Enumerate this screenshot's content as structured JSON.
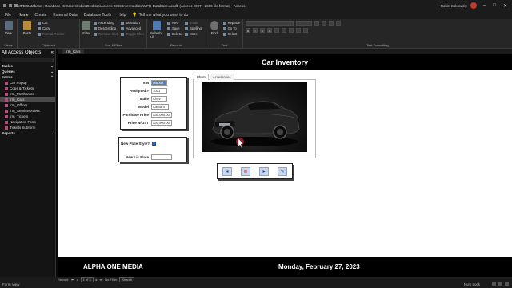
{
  "window": {
    "title": "MPD Database : Database- C:\\Users\\robin\\Desktop\\Access 0365 Intermediate\\MPD Database.accdb (Access 2007 - 2016 file format) - Access",
    "user": "Robin Sokowsky"
  },
  "ribbon_tabs": [
    "File",
    "Home",
    "Create",
    "External Data",
    "Database Tools",
    "Help"
  ],
  "tell_me": "Tell me what you want to do",
  "ribbon": {
    "views": {
      "button": "View",
      "group": "Views"
    },
    "clipboard": {
      "paste": "Paste",
      "cut": "Cut",
      "copy": "Copy",
      "format_painter": "Format Painter",
      "group": "Clipboard"
    },
    "sort_filter": {
      "filter": "Filter",
      "ascending": "Ascending",
      "descending": "Descending",
      "remove_sort": "Remove Sort",
      "selection": "Selection",
      "advanced": "Advanced",
      "toggle_filter": "Toggle Filter",
      "group": "Sort & Filter"
    },
    "records": {
      "refresh": "Refresh All",
      "new": "New",
      "save": "Save",
      "delete": "Delete",
      "totals": "Totals",
      "spelling": "Spelling",
      "more": "More",
      "group": "Records"
    },
    "find": {
      "find": "Find",
      "replace": "Replace",
      "goto": "Go To",
      "select": "Select",
      "group": "Find"
    },
    "text_formatting": {
      "group": "Text Formatting"
    }
  },
  "nav_pane": {
    "title": "All Access Objects",
    "sections": {
      "tables": "Tables",
      "queries": "Queries",
      "forms": "Forms",
      "reports": "Reports"
    },
    "forms": [
      "Car Popup",
      "Cops & Tickets",
      "frm_Mechanics",
      "frm_Cars",
      "frm_Officer",
      "frm_ServiceOrders",
      "frm_Tickets",
      "Navigation Form",
      "Tickets Subform"
    ],
    "selected_form": "frm_Cars"
  },
  "doc_tab": "frm_Cars",
  "form": {
    "header": "Car Inventory",
    "fields": {
      "vin": {
        "label": "VIN",
        "value": "MB002"
      },
      "assigned": {
        "label": "Assigned #",
        "value": "1001"
      },
      "make": {
        "label": "Make",
        "value": "Chev"
      },
      "model": {
        "label": "Model",
        "value": "Camaro"
      },
      "purchase_price": {
        "label": "Purchase Price",
        "value": "$30,000.00"
      },
      "price_gst": {
        "label": "Price w/GST",
        "value": "$30,900.00"
      }
    },
    "new_plate_label": "New Plate Style?",
    "new_plate_checked": true,
    "new_lic_label": "New Lic Plate",
    "new_lic_value": "",
    "tabs": [
      "Photo",
      "Accessories"
    ],
    "footer_left": "ALPHA ONE MEDIA",
    "footer_right": "Monday, February 27, 2023"
  },
  "status": {
    "record_label": "Record:",
    "record_pos": "1 of 3",
    "filter": "No Filter",
    "search": "Search",
    "mode": "Form View",
    "numlock": "Num Lock"
  },
  "colors": {
    "accent": "#2b6cc4",
    "header_bg": "#000000",
    "nav_selected": "#4a4a4a"
  }
}
